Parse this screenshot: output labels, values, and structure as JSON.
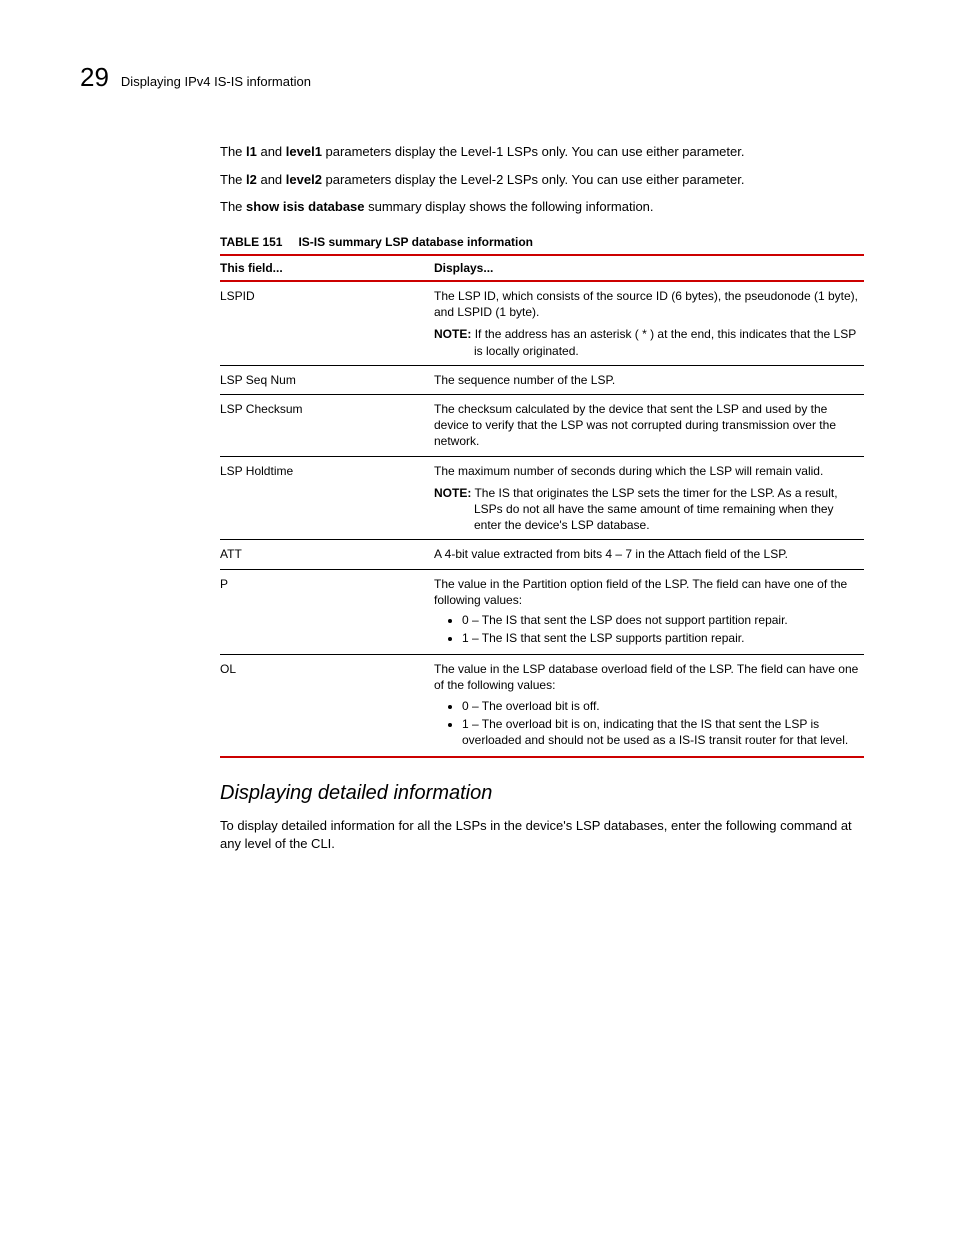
{
  "header": {
    "chapter_number": "29",
    "chapter_title": "Displaying IPv4 IS-IS information"
  },
  "paragraphs": {
    "p1_pre": "The ",
    "p1_b1": "l1",
    "p1_mid1": " and ",
    "p1_b2": "level1",
    "p1_post": " parameters display the Level-1 LSPs only.  You can use either parameter.",
    "p2_pre": "The ",
    "p2_b1": "l2",
    "p2_mid1": " and ",
    "p2_b2": "level2",
    "p2_post": " parameters display the Level-2 LSPs only.  You can use either parameter.",
    "p3_pre": "The ",
    "p3_b1": "show isis database",
    "p3_post": " summary display shows the following information."
  },
  "table": {
    "label": "TABLE 151",
    "title": "IS-IS summary LSP database information",
    "head_field": "This field...",
    "head_displays": "Displays...",
    "rows": {
      "r0": {
        "field": "LSPID",
        "body": "The LSP ID, which consists of the source ID (6 bytes), the pseudonode (1 byte), and LSPID (1 byte).",
        "note_label": "NOTE:",
        "note": "If the address has an asterisk ( * ) at the end, this indicates that the LSP is locally originated."
      },
      "r1": {
        "field": "LSP Seq Num",
        "body": "The sequence number of the LSP."
      },
      "r2": {
        "field": "LSP Checksum",
        "body": "The checksum calculated by the device that sent the LSP and used by the device to verify that the LSP was not corrupted during transmission over the network."
      },
      "r3": {
        "field": "LSP Holdtime",
        "body": "The maximum number of seconds during which the LSP will remain valid.",
        "note_label": "NOTE:",
        "note": "The IS that originates the LSP sets the timer for the LSP. As a result, LSPs do not all have the same amount of time remaining when they enter the device's LSP database."
      },
      "r4": {
        "field": "ATT",
        "body": "A 4-bit value extracted from bits 4 – 7 in the Attach field of the LSP."
      },
      "r5": {
        "field": "P",
        "body": "The value in the Partition option field of the LSP.  The field can have one of the following values:",
        "b0": "0 – The IS that sent the LSP does not support partition repair.",
        "b1": "1 – The IS that sent the LSP supports partition repair."
      },
      "r6": {
        "field": "OL",
        "body": "The value in the LSP database overload field of the LSP.  The field can have one of the following values:",
        "b0": "0 – The overload bit is off.",
        "b1": "1 – The overload bit is on, indicating that the IS that sent the LSP is overloaded and should not be used as a IS-IS transit router for that level."
      }
    }
  },
  "section2": {
    "heading": "Displaying detailed information",
    "para": "To display detailed information for all the LSPs in the device's LSP databases, enter the following command at any level of the CLI."
  }
}
